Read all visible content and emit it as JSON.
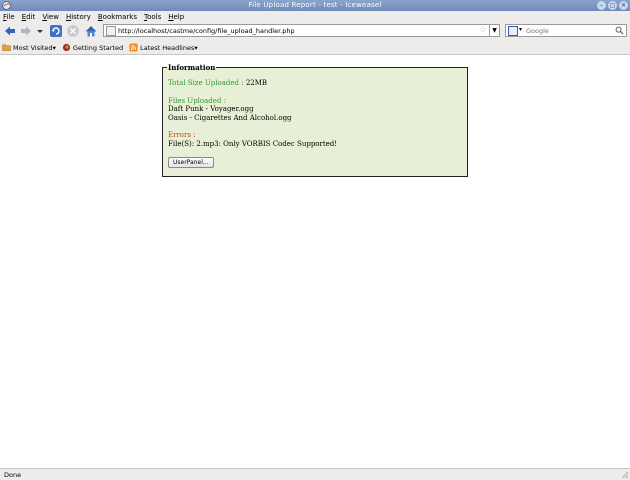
{
  "window": {
    "title": "File Upload Report - test - Iceweasel"
  },
  "menu": {
    "items": [
      {
        "label": "File",
        "u": "F",
        "rest": "ile"
      },
      {
        "label": "Edit",
        "u": "E",
        "rest": "dit"
      },
      {
        "label": "View",
        "u": "V",
        "rest": "iew"
      },
      {
        "label": "History",
        "u": "H",
        "rest": "istory"
      },
      {
        "label": "Bookmarks",
        "u": "B",
        "rest": "ookmarks"
      },
      {
        "label": "Tools",
        "u": "T",
        "rest": "ools"
      },
      {
        "label": "Help",
        "u": "H",
        "rest": "elp"
      }
    ]
  },
  "navbar": {
    "url": "http://localhost/castme/config/file_upload_handler.php",
    "search_placeholder": "Google"
  },
  "bookmarks": {
    "most_visited": "Most Visited",
    "getting_started": "Getting Started",
    "latest_headlines": "Latest Headlines"
  },
  "report": {
    "legend": "Information",
    "total_label": "Total Size Uploaded :",
    "total_value": "22MB",
    "files_label": "Files Uploaded :",
    "files": [
      "Daft Punk - Voyager.ogg",
      "Oasis - Cigarettes And Alcohol.ogg"
    ],
    "errors_label": "Errors :",
    "error_text": "File(S): 2.mp3: Only VORBIS Codec Supported!",
    "button_label": "UserPanel..."
  },
  "status": {
    "text": "Done"
  },
  "colors": {
    "panel_bg": "#e7f0d6",
    "label_green": "#2e9a2e",
    "label_red": "#c8401e"
  }
}
